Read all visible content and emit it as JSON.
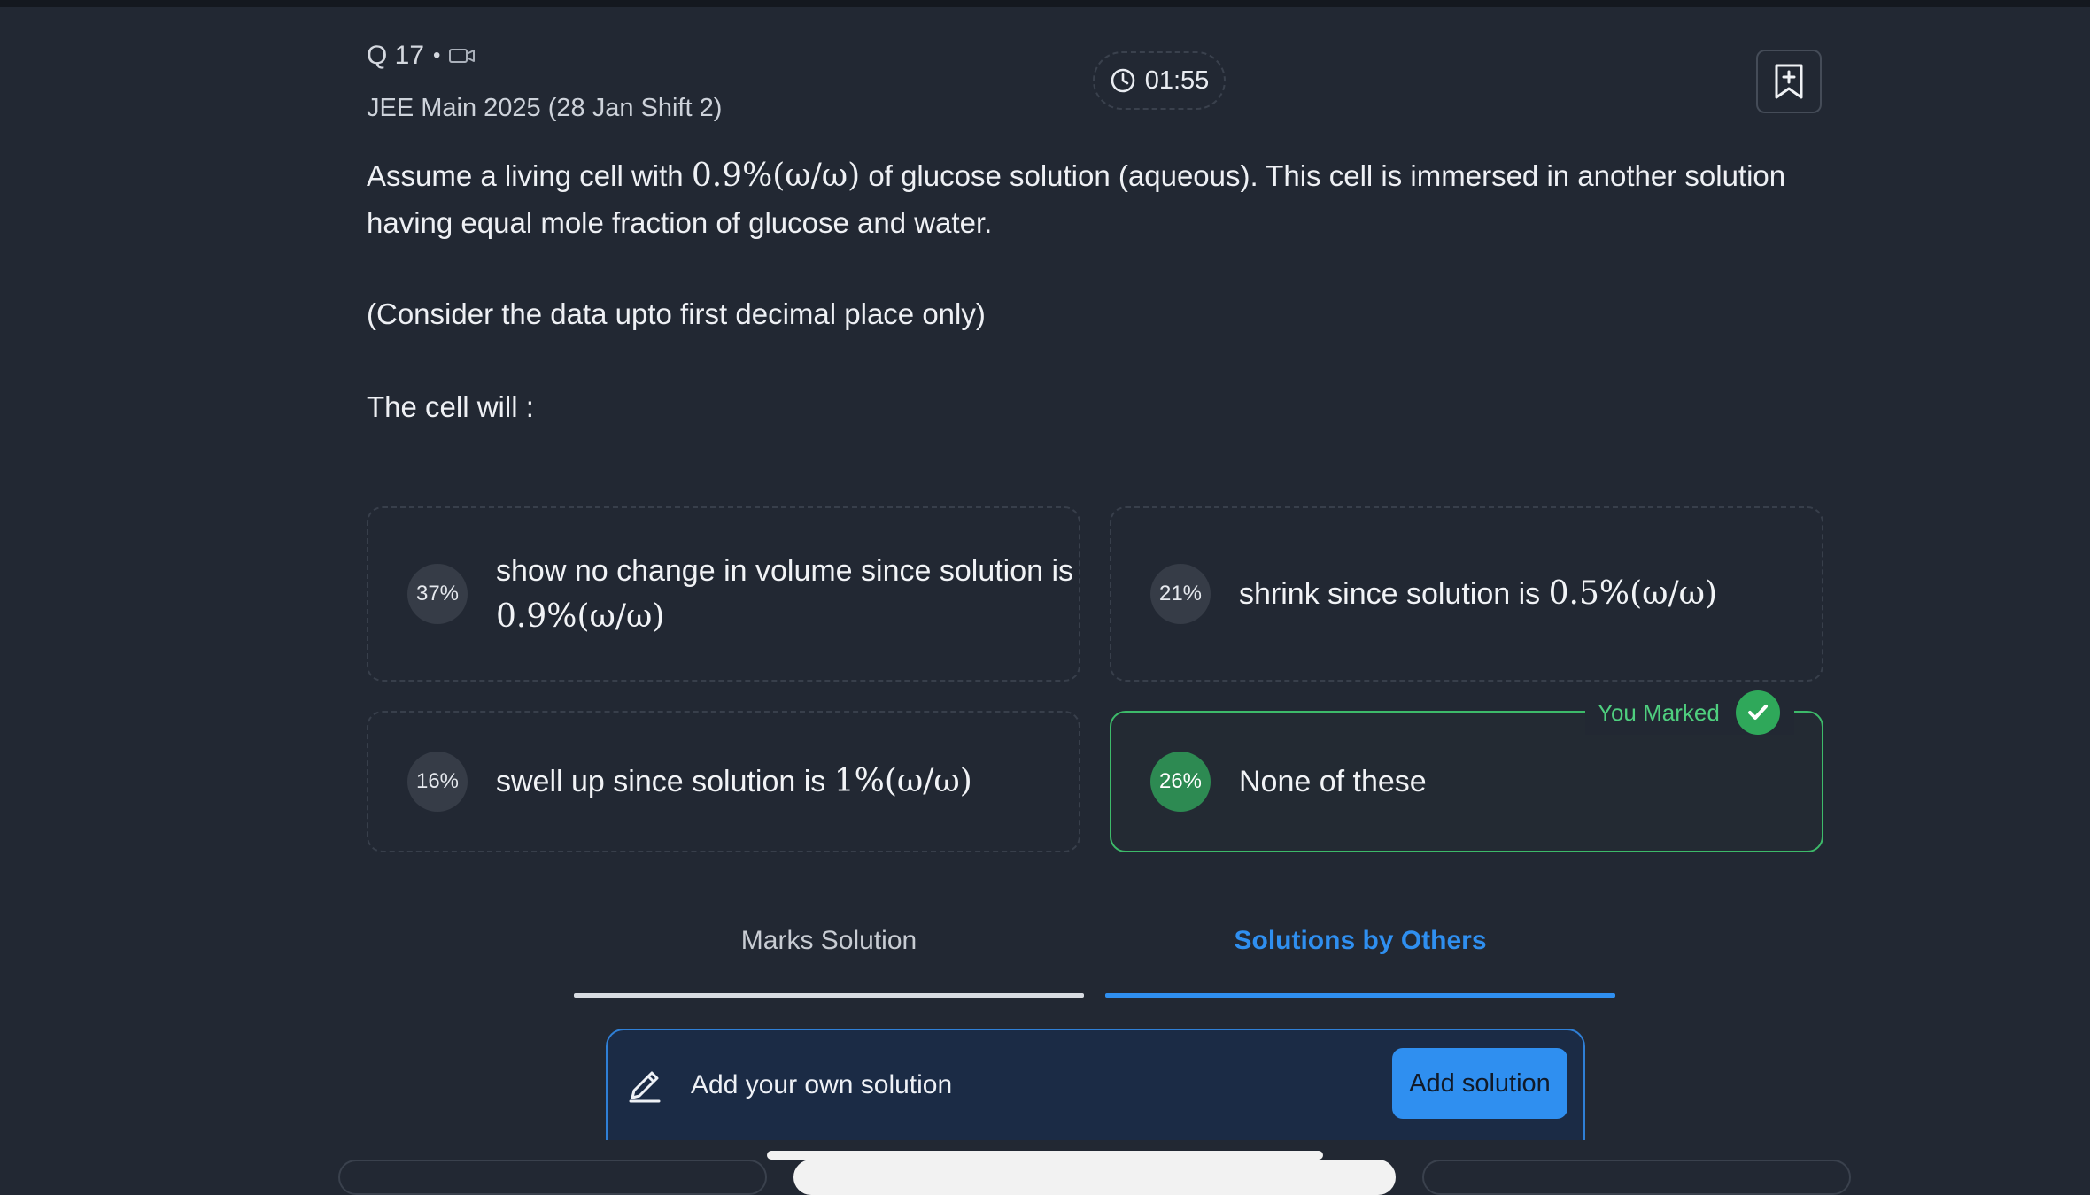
{
  "question": {
    "number_label": "Q 17",
    "separator": "•",
    "video_icon": "video-camera-icon",
    "exam_label": "JEE Main 2025 (28 Jan Shift 2)",
    "timer": "01:55",
    "timer_icon": "clock-icon",
    "bookmark_icon": "bookmark-add-icon",
    "text_part1": "Assume a living cell with",
    "text_math": "0.9%(ω/ω)",
    "text_part2": "of glucose solution (aqueous). This cell is immersed in another solution having equal mole fraction of glucose and water.",
    "note": "(Consider the data upto first decimal place only)",
    "prompt": "The cell will :"
  },
  "options": [
    {
      "percent": "37%",
      "text": "show no change in volume since solution is",
      "math": "0.9%(ω/ω)"
    },
    {
      "percent": "21%",
      "text": "shrink since solution is",
      "math": "0.5%(ω/ω)"
    },
    {
      "percent": "16%",
      "text": "swell up since solution is",
      "math": "1%(ω/ω)"
    },
    {
      "percent": "26%",
      "text": "None of these",
      "math": "",
      "selected": true
    }
  ],
  "marked_label": "You Marked",
  "tabs": {
    "marks_solution": "Marks Solution",
    "solutions_by_others": "Solutions by Others",
    "active": "solutions_by_others"
  },
  "add_solution": {
    "prompt": "Add your own solution",
    "button": "Add solution",
    "icon": "pencil-icon"
  },
  "colors": {
    "background": "#222833",
    "accent_blue": "#2f8ff0",
    "correct_green": "#3dba6a"
  }
}
